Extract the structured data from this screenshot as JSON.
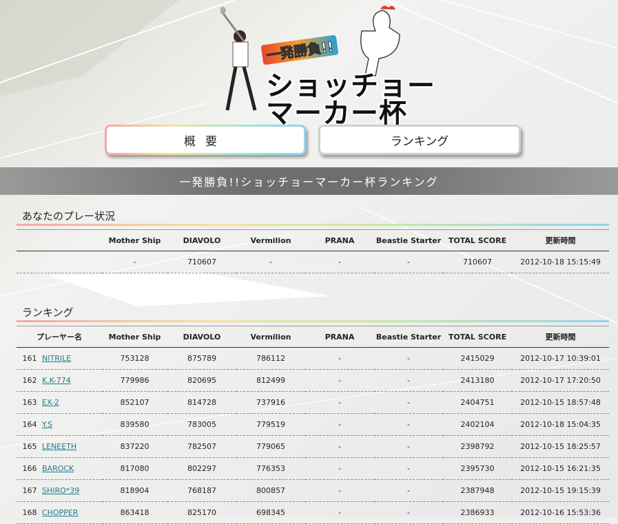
{
  "header": {
    "tagline": "一発勝負!!",
    "title_line1": "ショッチョー",
    "title_line2": "マーカー杯"
  },
  "nav": {
    "overview": "概要",
    "ranking": "ランキング"
  },
  "banner": "一発勝負!!ショッチョーマーカー杯ランキング",
  "my_status": {
    "heading": "あなたのプレー状況",
    "columns": [
      "",
      "Mother Ship",
      "DIAVOLO",
      "Vermilion",
      "PRANA",
      "Beastie Starter",
      "TOTAL SCORE",
      "更新時間"
    ],
    "row": [
      "",
      "-",
      "710607",
      "-",
      "-",
      "-",
      "710607",
      "2012-10-18 15:15:49"
    ]
  },
  "ranking": {
    "heading": "ランキング",
    "columns": [
      "プレーヤー名",
      "Mother Ship",
      "DIAVOLO",
      "Vermilion",
      "PRANA",
      "Beastie Starter",
      "TOTAL SCORE",
      "更新時間"
    ],
    "rows": [
      {
        "rank": "161",
        "name": "NITRILE",
        "mother": "753128",
        "diavolo": "875789",
        "vermilion": "786112",
        "prana": "-",
        "beastie": "-",
        "total": "2415029",
        "updated": "2012-10-17 10:39:01"
      },
      {
        "rank": "162",
        "name": "K.K-774",
        "mother": "779986",
        "diavolo": "820695",
        "vermilion": "812499",
        "prana": "-",
        "beastie": "-",
        "total": "2413180",
        "updated": "2012-10-17 17:20:50"
      },
      {
        "rank": "163",
        "name": "EX-2",
        "mother": "852107",
        "diavolo": "814728",
        "vermilion": "737916",
        "prana": "-",
        "beastie": "-",
        "total": "2404751",
        "updated": "2012-10-15 18:57:48"
      },
      {
        "rank": "164",
        "name": "Y.S",
        "mother": "839580",
        "diavolo": "783005",
        "vermilion": "779519",
        "prana": "-",
        "beastie": "-",
        "total": "2402104",
        "updated": "2012-10-18 15:04:35"
      },
      {
        "rank": "165",
        "name": "LENEETH",
        "mother": "837220",
        "diavolo": "782507",
        "vermilion": "779065",
        "prana": "-",
        "beastie": "-",
        "total": "2398792",
        "updated": "2012-10-15 18:25:57"
      },
      {
        "rank": "166",
        "name": "BAROCK",
        "mother": "817080",
        "diavolo": "802297",
        "vermilion": "776353",
        "prana": "-",
        "beastie": "-",
        "total": "2395730",
        "updated": "2012-10-15 16:21:35"
      },
      {
        "rank": "167",
        "name": "SHIRO*39",
        "mother": "818904",
        "diavolo": "768187",
        "vermilion": "800857",
        "prana": "-",
        "beastie": "-",
        "total": "2387948",
        "updated": "2012-10-15 19:15:39"
      },
      {
        "rank": "168",
        "name": "CHOPPER",
        "mother": "863418",
        "diavolo": "825170",
        "vermilion": "698345",
        "prana": "-",
        "beastie": "-",
        "total": "2386933",
        "updated": "2012-10-16 15:53:36"
      }
    ]
  }
}
